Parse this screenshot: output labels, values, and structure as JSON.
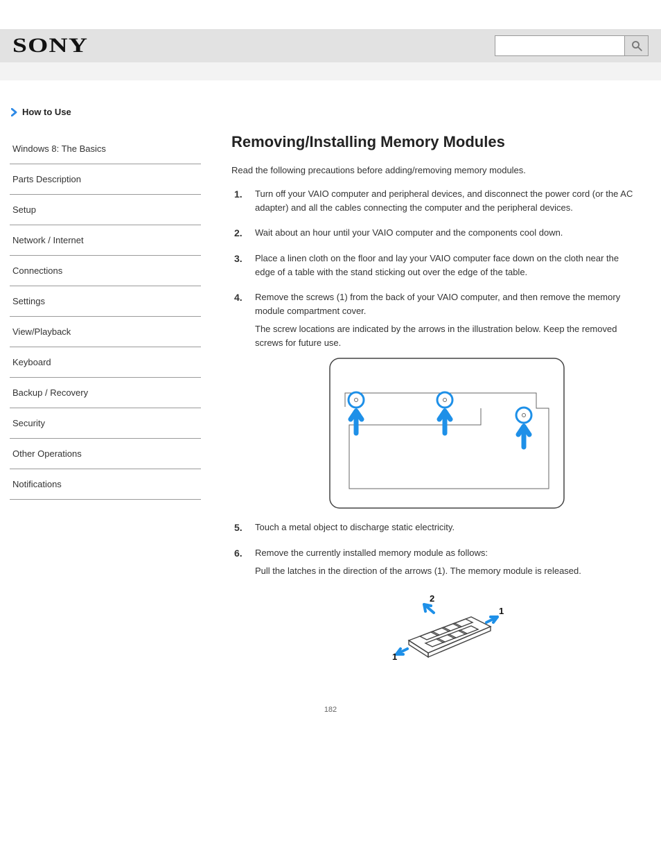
{
  "header": {
    "brand": "SONY",
    "search_placeholder": ""
  },
  "sidebar": {
    "howto_label": "How to Use",
    "items": [
      {
        "label": "Windows 8: The Basics"
      },
      {
        "label": "Parts Description"
      },
      {
        "label": "Setup"
      },
      {
        "label": "Network / Internet"
      },
      {
        "label": "Connections"
      },
      {
        "label": "Settings"
      },
      {
        "label": "View/Playback"
      },
      {
        "label": "Keyboard"
      },
      {
        "label": "Backup / Recovery"
      },
      {
        "label": "Security"
      },
      {
        "label": "Other Operations"
      },
      {
        "label": "Notifications"
      }
    ]
  },
  "main": {
    "breadcrumb": "",
    "title": "Removing/Installing Memory Modules",
    "intro": "Read the following precautions before adding/removing memory modules.",
    "steps": [
      {
        "text": "Turn off your VAIO computer and peripheral devices, and disconnect the power cord (or the AC adapter) and all the cables connecting the computer and the peripheral devices."
      },
      {
        "text": "Wait about an hour until your VAIO computer and the components cool down."
      },
      {
        "text": "Place a linen cloth on the floor and lay your VAIO computer face down on the cloth near the edge of a table with the stand sticking out over the edge of the table."
      },
      {
        "text": "Remove the screws (1) from the back of your VAIO computer, and then remove the memory module compartment cover.",
        "sub": "The screw locations are indicated by the arrows in the illustration below. Keep the removed screws for future use."
      },
      {
        "text": "Touch a metal object to discharge static electricity."
      },
      {
        "text": "Remove the currently installed memory module as follows:",
        "sub": "Pull the latches in the direction of the arrows (1). The memory module is released."
      }
    ]
  },
  "page_number": "182"
}
